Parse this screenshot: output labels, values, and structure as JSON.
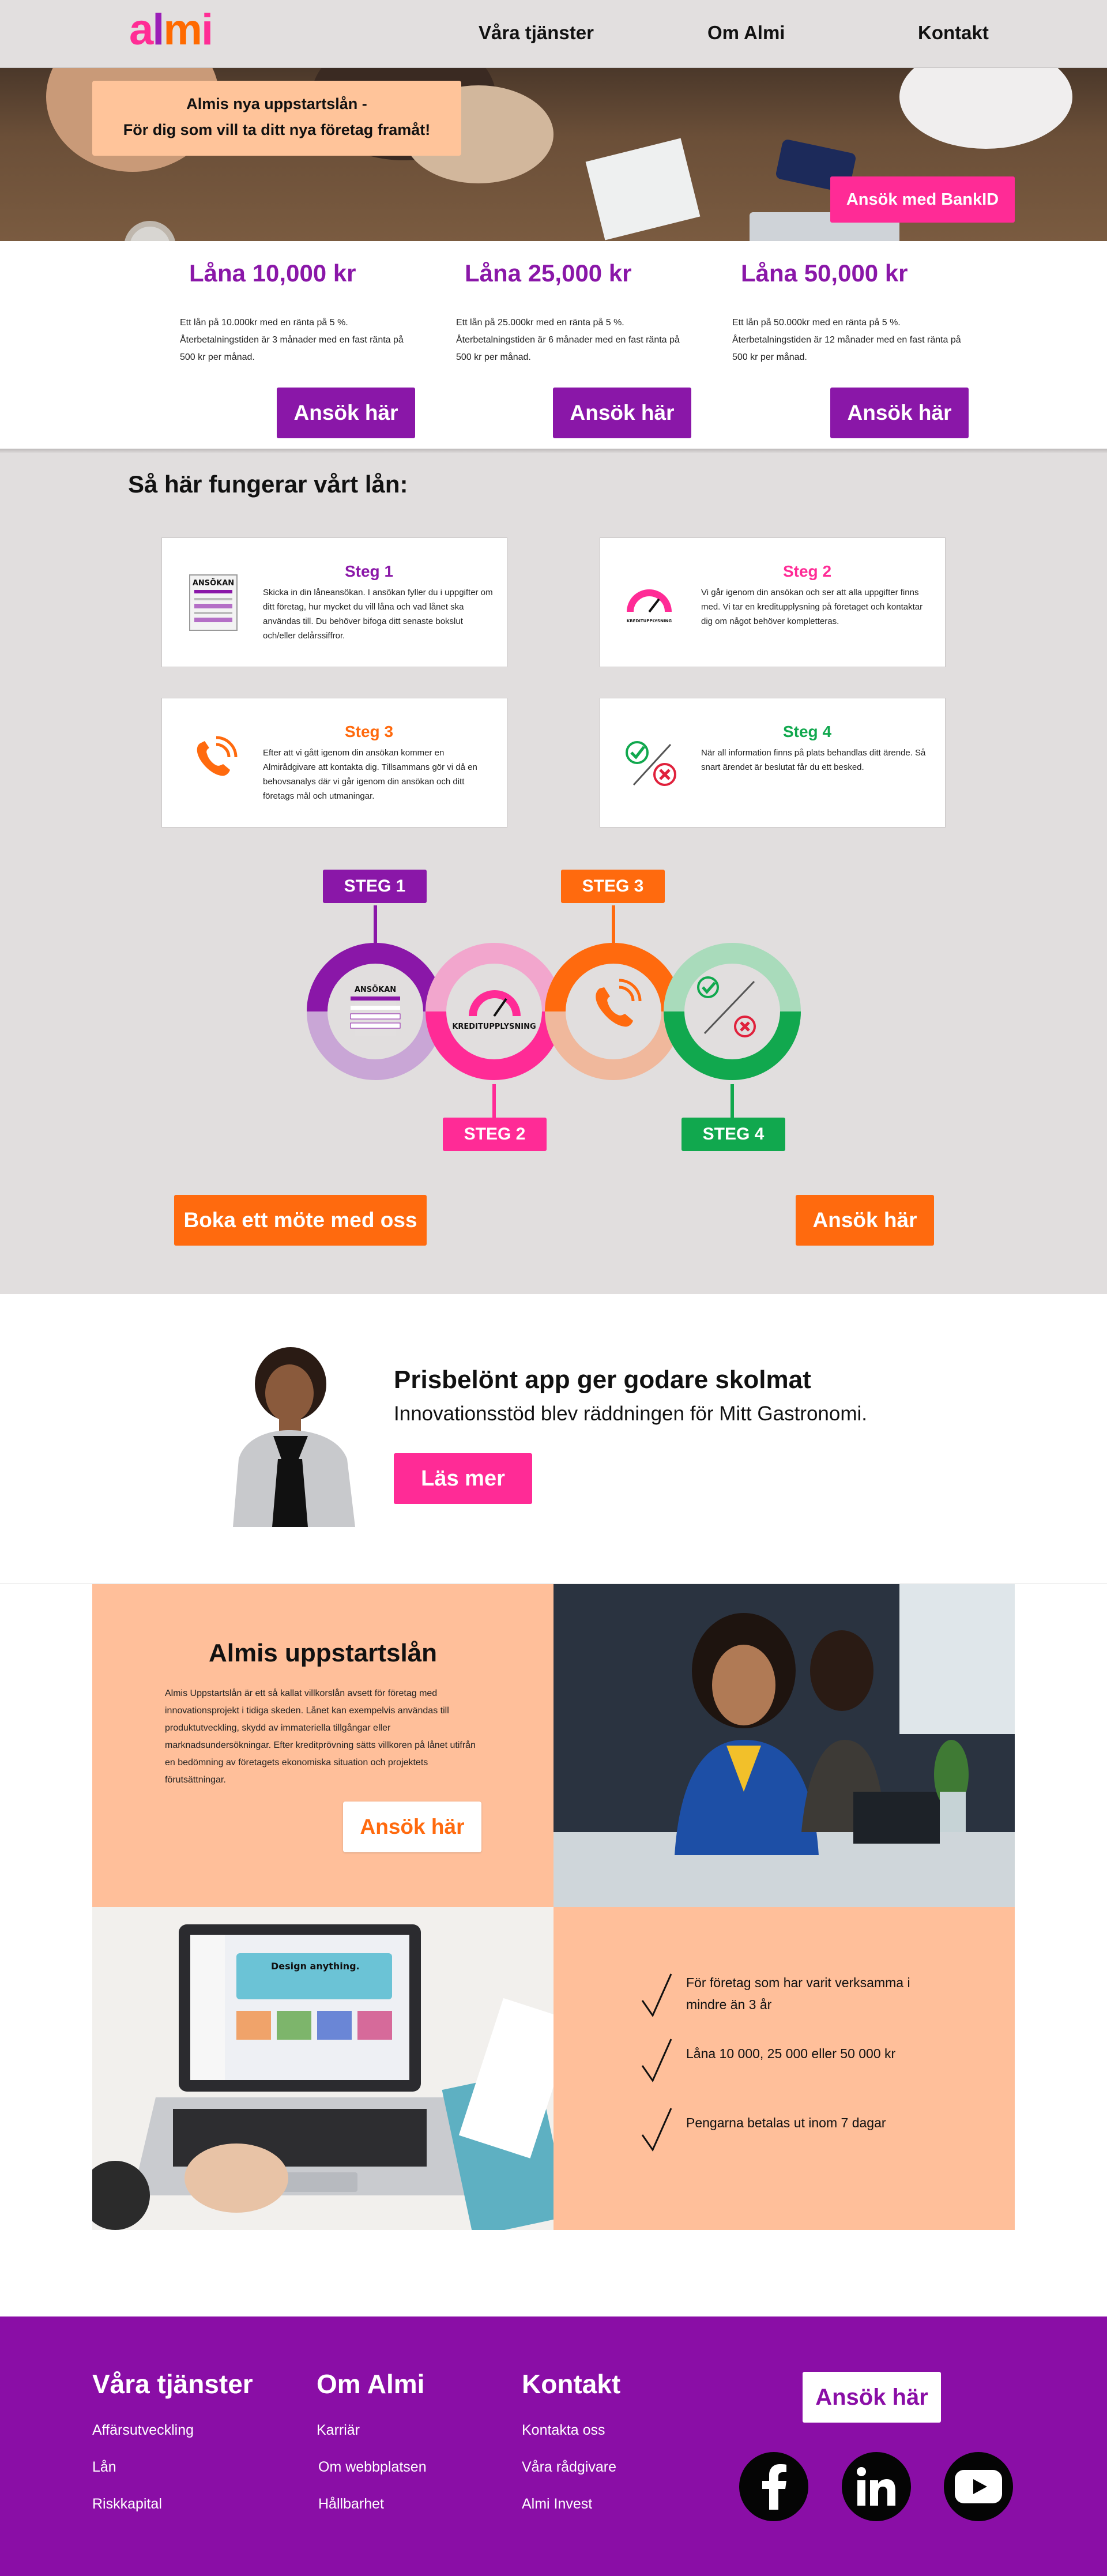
{
  "header": {
    "logo": [
      "a",
      "l",
      "m",
      "i"
    ],
    "nav": [
      "Våra tjänster",
      "Om Almi",
      "Kontakt"
    ]
  },
  "hero": {
    "banner_line1": "Almis nya uppstartslån -",
    "banner_line2": "För dig som vill ta ditt nya företag framåt!",
    "bankid_button": "Ansök med BankID"
  },
  "loans": [
    {
      "title": "Låna 10,000 kr",
      "desc": "Ett lån på 10.000kr med en ränta på 5 %. Återbetalningstiden är 3 månader med en fast ränta på 500 kr per månad.",
      "button": "Ansök här"
    },
    {
      "title": "Låna 25,000 kr",
      "desc": "Ett lån på 25.000kr med en ränta på 5 %. Återbetalningstiden är 6 månader med en fast ränta på 500 kr per månad.",
      "button": "Ansök här"
    },
    {
      "title": "Låna 50,000 kr",
      "desc": "Ett lån på 50.000kr med en ränta på 5 %. Återbetalningstiden är 12 månader med en fast ränta på 500 kr per månad.",
      "button": "Ansök här"
    }
  ],
  "how": {
    "title": "Så här fungerar vårt lån:",
    "steps": [
      {
        "title": "Steg 1",
        "text": "Skicka in din låneansökan. I ansökan fyller du i uppgifter om ditt företag, hur mycket du vill låna och vad lånet ska användas till. Du behöver bifoga ditt senaste bokslut och/eller delårssiffror.",
        "color": "#8a17a8",
        "icon": "ansokan-icon"
      },
      {
        "title": "Steg 2",
        "text": "Vi går igenom din ansökan och ser att alla uppgifter finns med. Vi tar en kreditupplysning på företaget och kontaktar dig om något behöver kompletteras.",
        "color": "#ff2b96",
        "icon": "kreditupplysning-gauge-icon"
      },
      {
        "title": "Steg 3",
        "text": "Efter att vi gått igenom din ansökan kommer en Almirådgivare att kontakta dig. Tillsammans gör vi då en behovsanalys där vi går igenom din ansökan och ditt företags mål och utmaningar.",
        "color": "#ff6a0e",
        "icon": "phone-icon"
      },
      {
        "title": "Steg 4",
        "text": "När all information finns på plats behandlas ditt ärende. Så snart ärendet är beslutat får du ett besked.",
        "color": "#11a84e",
        "icon": "approve-decline-icon"
      }
    ],
    "diagram_labels": [
      "STEG 1",
      "STEG 2",
      "STEG 3",
      "STEG 4"
    ],
    "diagram_text": {
      "ansokan": "ANSÖKAN",
      "kredit": "KREDITUPPLYSNING",
      "kredit_small": "KREDITUPPLYSNING"
    },
    "book_button": "Boka ett möte med oss",
    "apply_button": "Ansök här"
  },
  "testimonial": {
    "title": "Prisbelönt app ger godare skolmat",
    "subtitle": "Innovationsstöd blev räddningen för Mitt Gastronomi.",
    "button": "Läs mer"
  },
  "uppstart": {
    "title": "Almis uppstartslån",
    "text": "Almis Uppstartslån är ett så kallat villkorslån avsett för företag med innovationsprojekt i tidiga skeden. Lånet kan exempelvis användas till produktutveckling, skydd av immateriella tillgångar eller marknadsundersökningar. Efter kreditprövning sätts villkoren på lånet utifrån en bedömning av företagets ekonomiska situation och projektets förutsättningar.",
    "button": "Ansök här",
    "laptop_screen": "Design anything.",
    "checks": [
      "För företag som har varit verksamma i mindre än 3 år",
      "Låna 10 000, 25 000 eller 50 000 kr",
      "Pengarna betalas ut inom 7 dagar"
    ]
  },
  "footer": {
    "col1": {
      "title": "Våra tjänster",
      "links": [
        "Affärsutveckling",
        "Lån",
        "Riskkapital"
      ]
    },
    "col2": {
      "title": "Om Almi",
      "links": [
        "Karriär",
        "Om webbplatsen",
        "Hållbarhet"
      ]
    },
    "col3": {
      "title": "Kontakt",
      "links": [
        "Kontakta oss",
        "Våra rådgivare",
        "Almi Invest"
      ]
    },
    "button": "Ansök här",
    "social": [
      "facebook-icon",
      "linkedin-icon",
      "youtube-icon"
    ]
  }
}
